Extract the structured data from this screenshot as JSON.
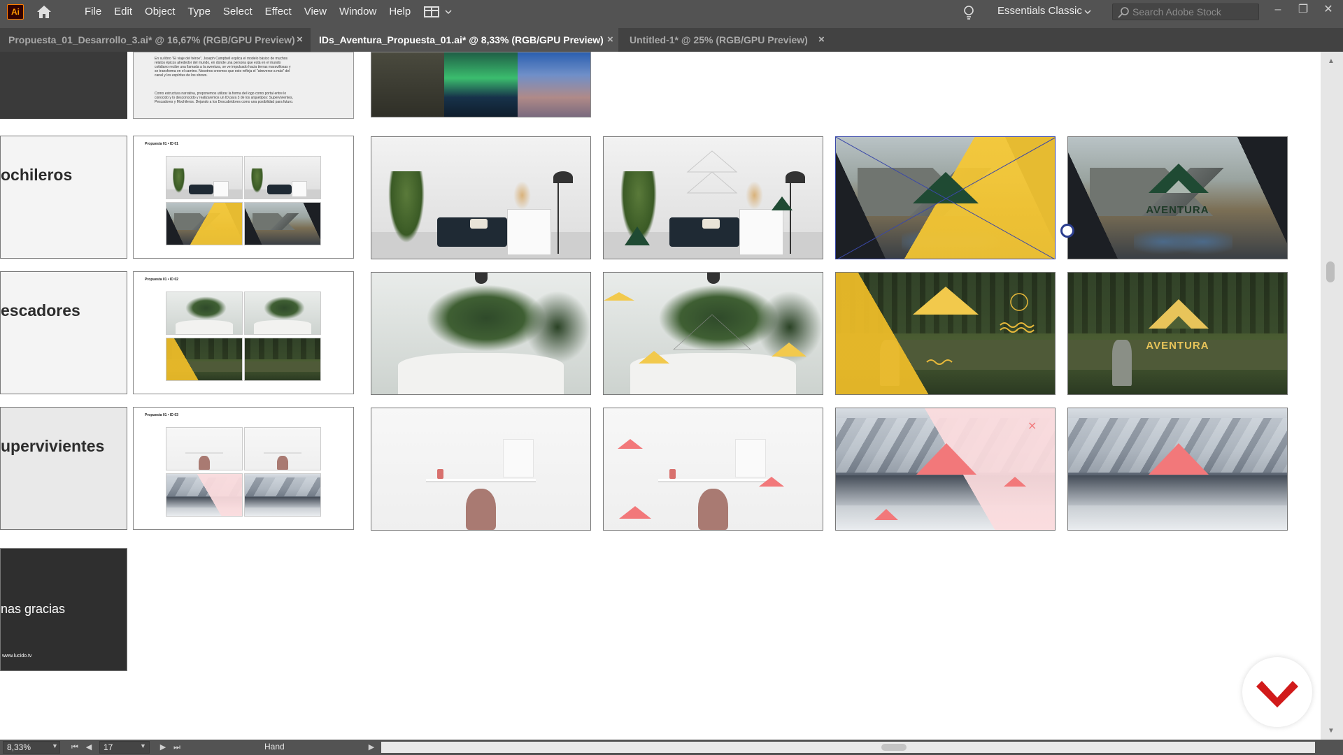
{
  "app": {
    "logo_text": "Ai",
    "menu": [
      "File",
      "Edit",
      "Object",
      "Type",
      "Select",
      "Effect",
      "View",
      "Window",
      "Help"
    ],
    "workspace": "Essentials Classic",
    "stock_search_placeholder": "Search Adobe Stock"
  },
  "tabs": [
    {
      "label": "Propuesta_01_Desarrollo_3.ai* @ 16,67% (RGB/GPU Preview)",
      "close": "×"
    },
    {
      "label": "IDs_Aventura_Propuesta_01.ai* @ 8,33% (RGB/GPU Preview)",
      "close": "×"
    },
    {
      "label": "Untitled-1* @ 25% (RGB/GPU Preview)",
      "close": "×"
    }
  ],
  "canvas": {
    "top_text_paragraphs": [
      "En su libro \"El viaje del héroe\", Joseph Campbell explica el modelo básico de muchos relatos épicos alrededor del mundo, en donde una persona que está en el mundo cotidiano recibe una llamada a la aventura, se ve impulsado hacia tierras maravillosas y se transforma en el camino. Nosotros creemos que esto refleja el \"atreverse a más\" del canal y los espíritus de los shows.",
      "Como estructura narrativa, proponemos utilizar la forma del logo como portal entre lo conocido y lo desconocido y realizaremos un ID para 3 de los arquetipos: Supervivientes, Pescadores y Mochileros. Dejando a los Descubridores como una posibilidad para futuro."
    ],
    "rows": [
      {
        "label": "ochileros",
        "summary_title": "Propuesta 01 • ID 01",
        "wordmark": "AVENTURA"
      },
      {
        "label": "escadores",
        "summary_title": "Propuesta 01 • ID 02",
        "wordmark": "AVENTURA"
      },
      {
        "label": "upervivientes",
        "summary_title": "Propuesta 01 • ID 03",
        "wordmark": ""
      }
    ],
    "closing_text": "nas gracias",
    "closing_url": "www.lucido.tv"
  },
  "status": {
    "zoom": "8,33%",
    "artboard_number": "17",
    "tool": "Hand"
  },
  "colors": {
    "accent_yellow": "#f7c832",
    "accent_pink": "#f2787a",
    "brand_green": "#2a4a2c",
    "brand_red": "#d11a1a"
  }
}
